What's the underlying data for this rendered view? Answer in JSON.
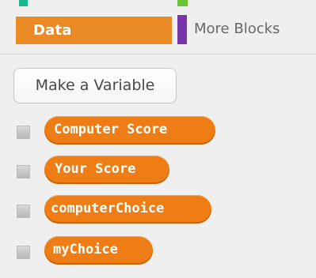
{
  "palette": {
    "tabs": [
      {
        "label": "Data",
        "selected": true,
        "color": "#ea8a24"
      },
      {
        "label": "More Blocks",
        "selected": false,
        "color": "#7835a8"
      }
    ],
    "top_accents": [
      {
        "name": "green-accent",
        "color": "#18b88c"
      },
      {
        "name": "lime-accent",
        "color": "#67c534"
      }
    ],
    "actions": {
      "make_variable": "Make a Variable"
    },
    "variables": [
      {
        "label": "Computer Score",
        "checked": false
      },
      {
        "label": "Your Score",
        "checked": false
      },
      {
        "label": "computerChoice",
        "checked": false
      },
      {
        "label": "myChoice",
        "checked": false
      }
    ],
    "colors": {
      "variable_block": "#ee7d16",
      "checkbox": "#c7c7c7",
      "background": "#efefef"
    },
    "icons": {
      "checkbox": "checkbox-icon"
    }
  }
}
